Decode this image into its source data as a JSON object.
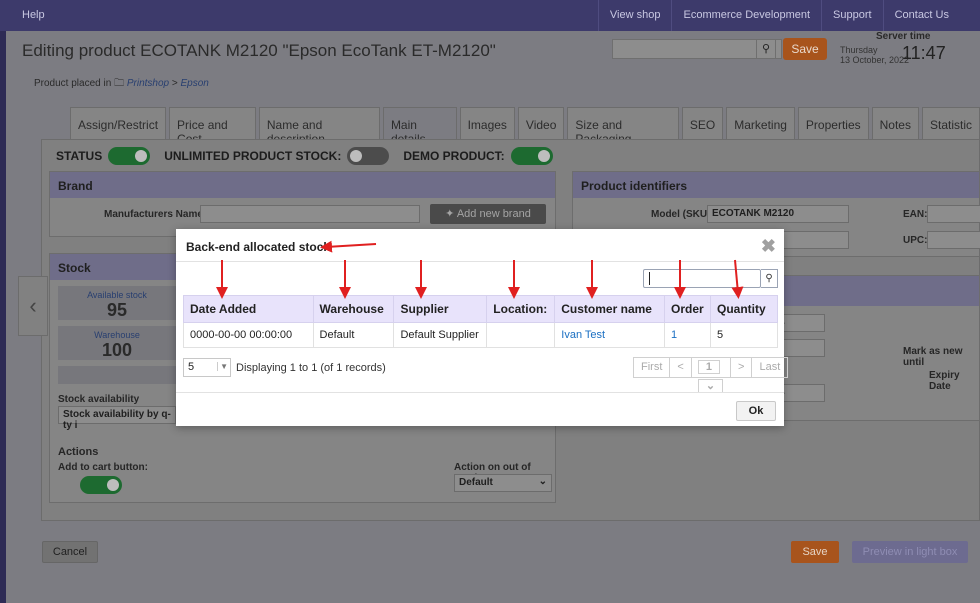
{
  "topbar": {
    "help": "Help",
    "menu": [
      "View shop",
      "Ecommerce Development",
      "Support",
      "Contact Us"
    ]
  },
  "header": {
    "title": "Editing product ECOTANK M2120 \"Epson EcoTank ET-M2120\"",
    "save": "Save",
    "server_time_label": "Server time",
    "server_day": "Thursday",
    "server_date": "13 October, 2022",
    "server_time": "11:47"
  },
  "placed": {
    "label": "Product placed in",
    "category": "Printshop",
    "subcategory": "Epson"
  },
  "tabs": [
    "Assign/Restrict",
    "Price and Cost",
    "Name and description",
    "Main details",
    "Images",
    "Video",
    "Size and Packaging",
    "SEO",
    "Marketing",
    "Properties",
    "Notes",
    "Statistic"
  ],
  "status_row": {
    "status": "STATUS",
    "unlimited": "UNLIMITED PRODUCT STOCK:",
    "demo": "DEMO PRODUCT:"
  },
  "brand": {
    "title": "Brand",
    "manufacturers_label": "Manufacturers Name",
    "add_brand": "Add new brand"
  },
  "identifiers": {
    "title": "Product identifiers",
    "model_label": "Model (SKU):",
    "model_value": "ECOTANK M2120",
    "ean_label": "EAN:",
    "upc_label": "UPC:"
  },
  "stock": {
    "title": "Stock",
    "available_label": "Available stock",
    "available_value": "95",
    "warehouse_label": "Warehouse",
    "warehouse_value": "100",
    "availability_label": "Stock availability",
    "availability_value": "Stock availability by q-ty i",
    "actions": "Actions",
    "add_to_cart": "Add to cart button:",
    "out_of_stock_label": "Action on out of stock:",
    "out_of_stock_value": "Default"
  },
  "right_panel": {
    "mark_new": "Mark as new until",
    "expiry": "Expiry Date"
  },
  "bottom": {
    "cancel": "Cancel",
    "save": "Save",
    "preview": "Preview in light box"
  },
  "modal": {
    "title": "Back-end allocated stock",
    "columns": [
      "Date Added",
      "Warehouse",
      "Supplier",
      "Location:",
      "Customer name",
      "Order",
      "Quantity"
    ],
    "rows": [
      [
        "0000-00-00 00:00:00",
        "Default",
        "Default Supplier",
        "",
        "Ivan Test",
        "1",
        "5"
      ]
    ],
    "page_size": "5",
    "displaying": "Displaying 1 to 1 (of 1 records)",
    "pager": {
      "first": "First",
      "prev": "<",
      "current": "1",
      "next": ">",
      "last": "Last"
    },
    "ok": "Ok"
  },
  "colors": {
    "accent_orange": "#e07020",
    "header_purple": "#3d3a6b",
    "table_header": "#e8e3fb",
    "annotation_red": "#e02020"
  }
}
